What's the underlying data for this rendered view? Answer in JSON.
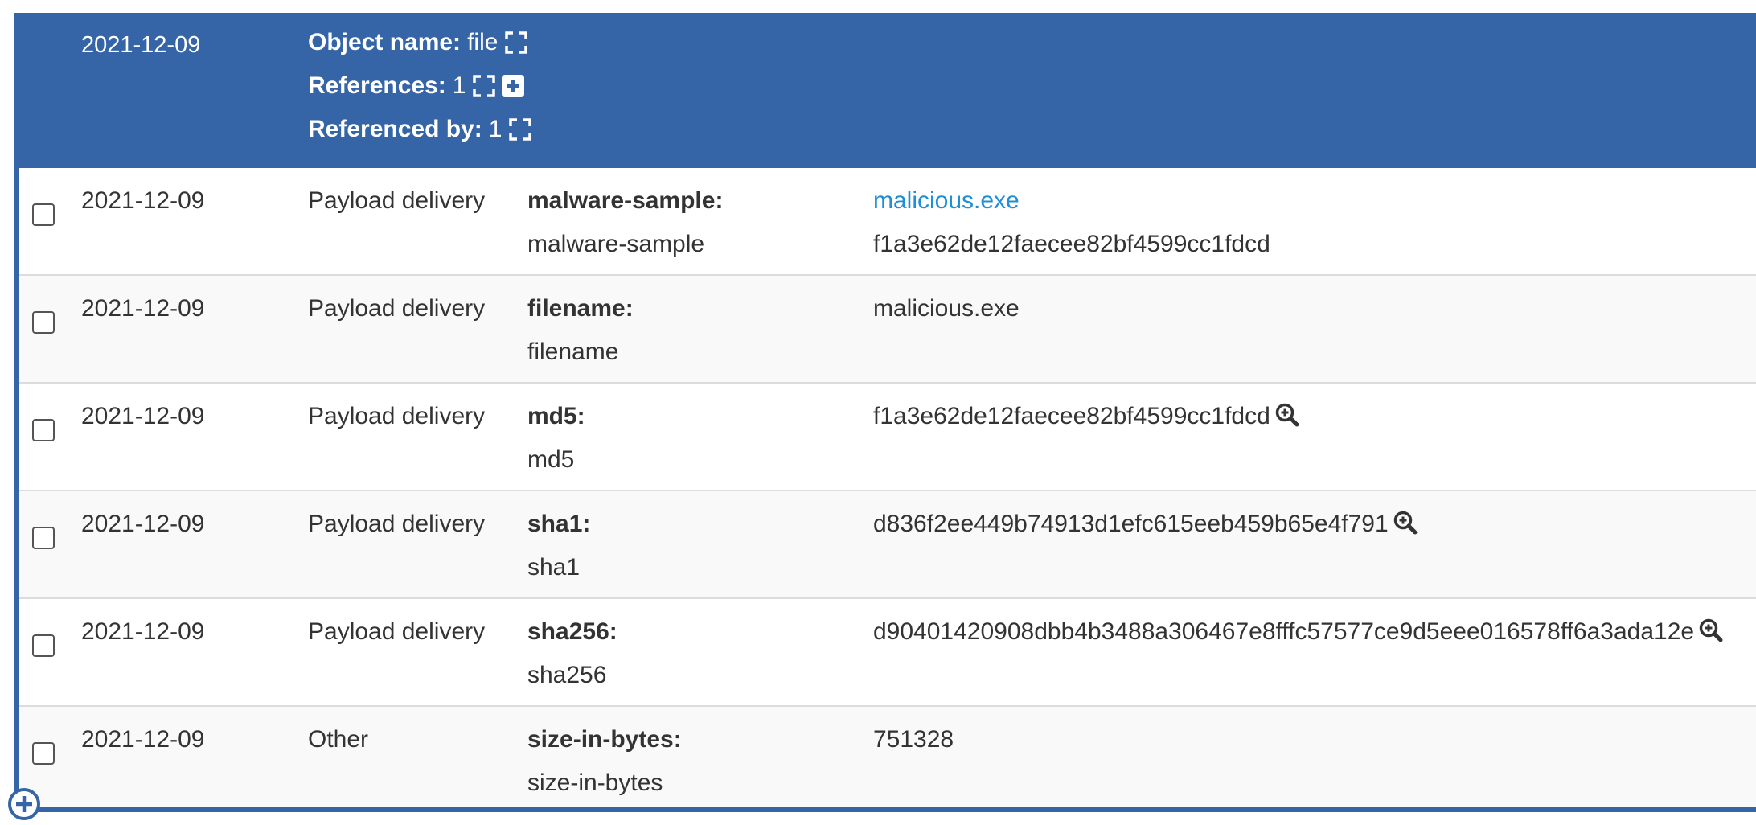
{
  "object": {
    "date": "2021-12-09",
    "name_label": "Object name:",
    "name_value": "file",
    "references_label": "References:",
    "references_value": "1",
    "referenced_by_label": "Referenced by:",
    "referenced_by_value": "1"
  },
  "rows": [
    {
      "date": "2021-12-09",
      "category": "Payload delivery",
      "type_name": "malware-sample:",
      "type_relation": "malware-sample",
      "value_line1": "malicious.exe",
      "value_line2": "f1a3e62de12faecee82bf4599cc1fdcd"
    },
    {
      "date": "2021-12-09",
      "category": "Payload delivery",
      "type_name": "filename:",
      "type_relation": "filename",
      "value_line1": "malicious.exe"
    },
    {
      "date": "2021-12-09",
      "category": "Payload delivery",
      "type_name": "md5:",
      "type_relation": "md5",
      "value_line1": "f1a3e62de12faecee82bf4599cc1fdcd"
    },
    {
      "date": "2021-12-09",
      "category": "Payload delivery",
      "type_name": "sha1:",
      "type_relation": "sha1",
      "value_line1": "d836f2ee449b74913d1efc615eeb459b65e4f791"
    },
    {
      "date": "2021-12-09",
      "category": "Payload delivery",
      "type_name": "sha256:",
      "type_relation": "sha256",
      "value_line1": "d90401420908dbb4b3488a306467e8fffc57577ce9d5eee016578ff6a3ada12e"
    },
    {
      "date": "2021-12-09",
      "category": "Other",
      "type_name": "size-in-bytes:",
      "type_relation": "size-in-bytes",
      "value_line1": "751328"
    }
  ],
  "icons": {
    "expand": "expand-icon",
    "add": "plus-square-icon",
    "search": "search-plus-icon",
    "add_attribute": "plus-circle-icon"
  },
  "colors": {
    "header_bg": "#3565a6",
    "link": "#1e8fd6",
    "row_alt": "#f9f9f9"
  }
}
